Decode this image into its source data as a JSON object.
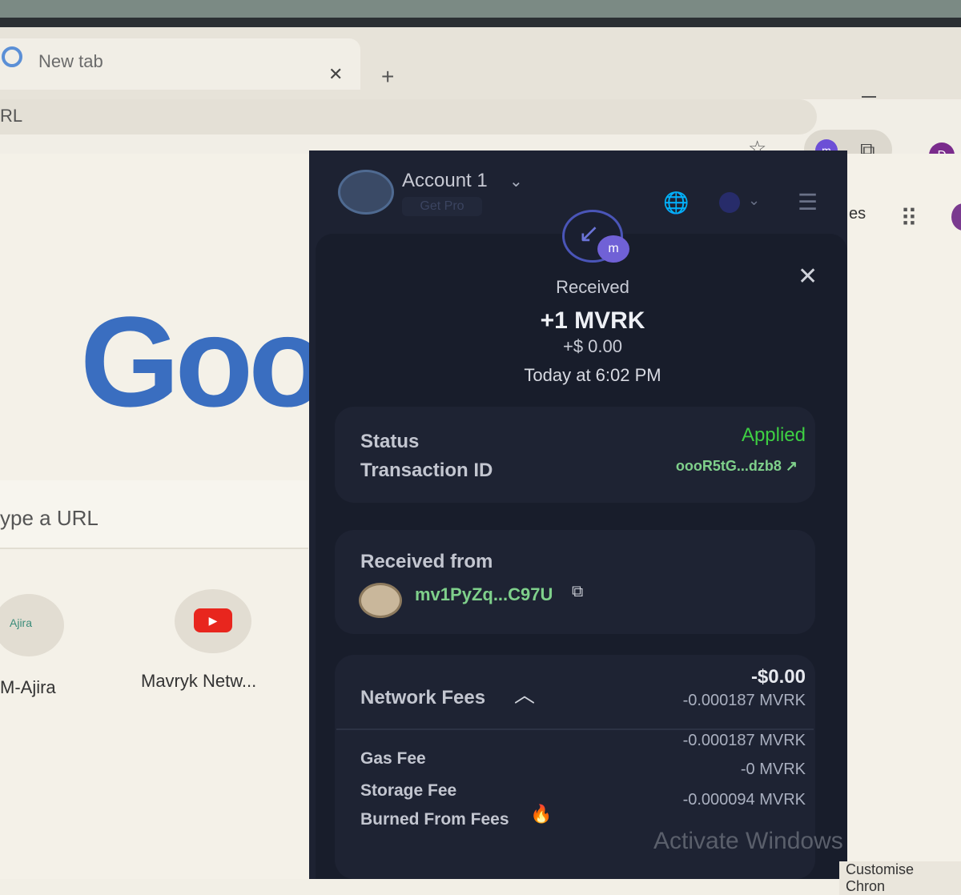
{
  "browser": {
    "tab_title": "New tab",
    "omnibox_fragment": "RL",
    "minimize_glyph": "—",
    "extension_m": "m",
    "profile_initial": "D"
  },
  "page": {
    "logo_fragment": "Goo",
    "search_placeholder": "ype a URL",
    "shortcuts": [
      {
        "label": "M-Ajira",
        "icon_text": "Ajira"
      },
      {
        "label": "Mavryk Netw...",
        "icon": "youtube-icon"
      }
    ],
    "side_text": "es",
    "watermark": "Activate Windows",
    "customise_button": "Customise Chron"
  },
  "wallet": {
    "account_name": "Account 1",
    "get_pro": "Get Pro",
    "badge_m": "m",
    "transaction": {
      "title": "Received",
      "amount": "+1 MVRK",
      "fiat": "+$ 0.00",
      "time": "Today at 6:02 PM"
    },
    "status_label": "Status",
    "status_value": "Applied",
    "txid_label": "Transaction ID",
    "txid_value": "oooR5tG...dzb8",
    "received_from_label": "Received from",
    "sender_address": "mv1PyZq...C97U",
    "network_fees_label": "Network Fees",
    "network_fees_fiat": "-$0.00",
    "network_fees_amount": "-0.000187 MVRK",
    "fees": [
      {
        "label": "Gas Fee",
        "value": "-0.000187 MVRK"
      },
      {
        "label": "Storage Fee",
        "value": "-0 MVRK"
      },
      {
        "label": "Burned From Fees",
        "value": "-0.000094 MVRK"
      }
    ]
  },
  "colors": {
    "wallet_bg": "#1d2232",
    "applied_green": "#3ecf43",
    "address_green": "#7fd08b",
    "accent_purple": "#7061d6"
  }
}
